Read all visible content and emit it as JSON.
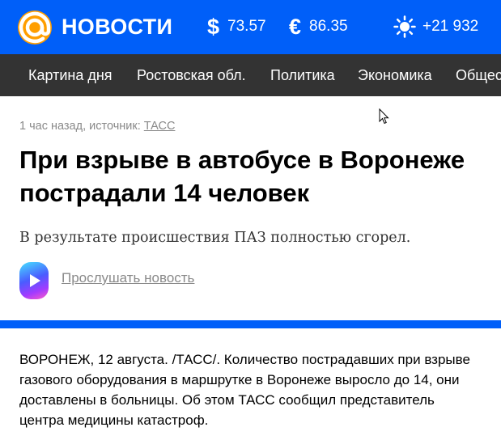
{
  "header": {
    "brand": "НОВОСТИ",
    "usd_symbol": "$",
    "usd_rate": "73.57",
    "eur_symbol": "€",
    "eur_rate": "86.35",
    "weather_icon": "sun-icon",
    "temperature": "+21 932"
  },
  "nav": {
    "items": [
      "Картина дня",
      "Ростовская обл.",
      "Политика",
      "Экономика",
      "Общес"
    ]
  },
  "article": {
    "time": "1 час назад, источник: ",
    "source": "ТАСС",
    "title": "При взрыве в автобусе в Воронеже пострадали 14 человек",
    "lead": "В результате происшествия ПАЗ полностью сгорел.",
    "listen_label": "Прослушать новость",
    "body": "ВОРОНЕЖ, 12 августа. /ТАСС/. Количество пострадавших при взрыве газового оборудования в маршрутке в Воронеже выросло до 14, они доставлены в больницы. Об этом ТАСС сообщил представитель центра медицины катастроф."
  },
  "colors": {
    "brand_blue": "#005ff9",
    "logo_orange": "#ff9e00",
    "nav_bg": "#333333"
  }
}
